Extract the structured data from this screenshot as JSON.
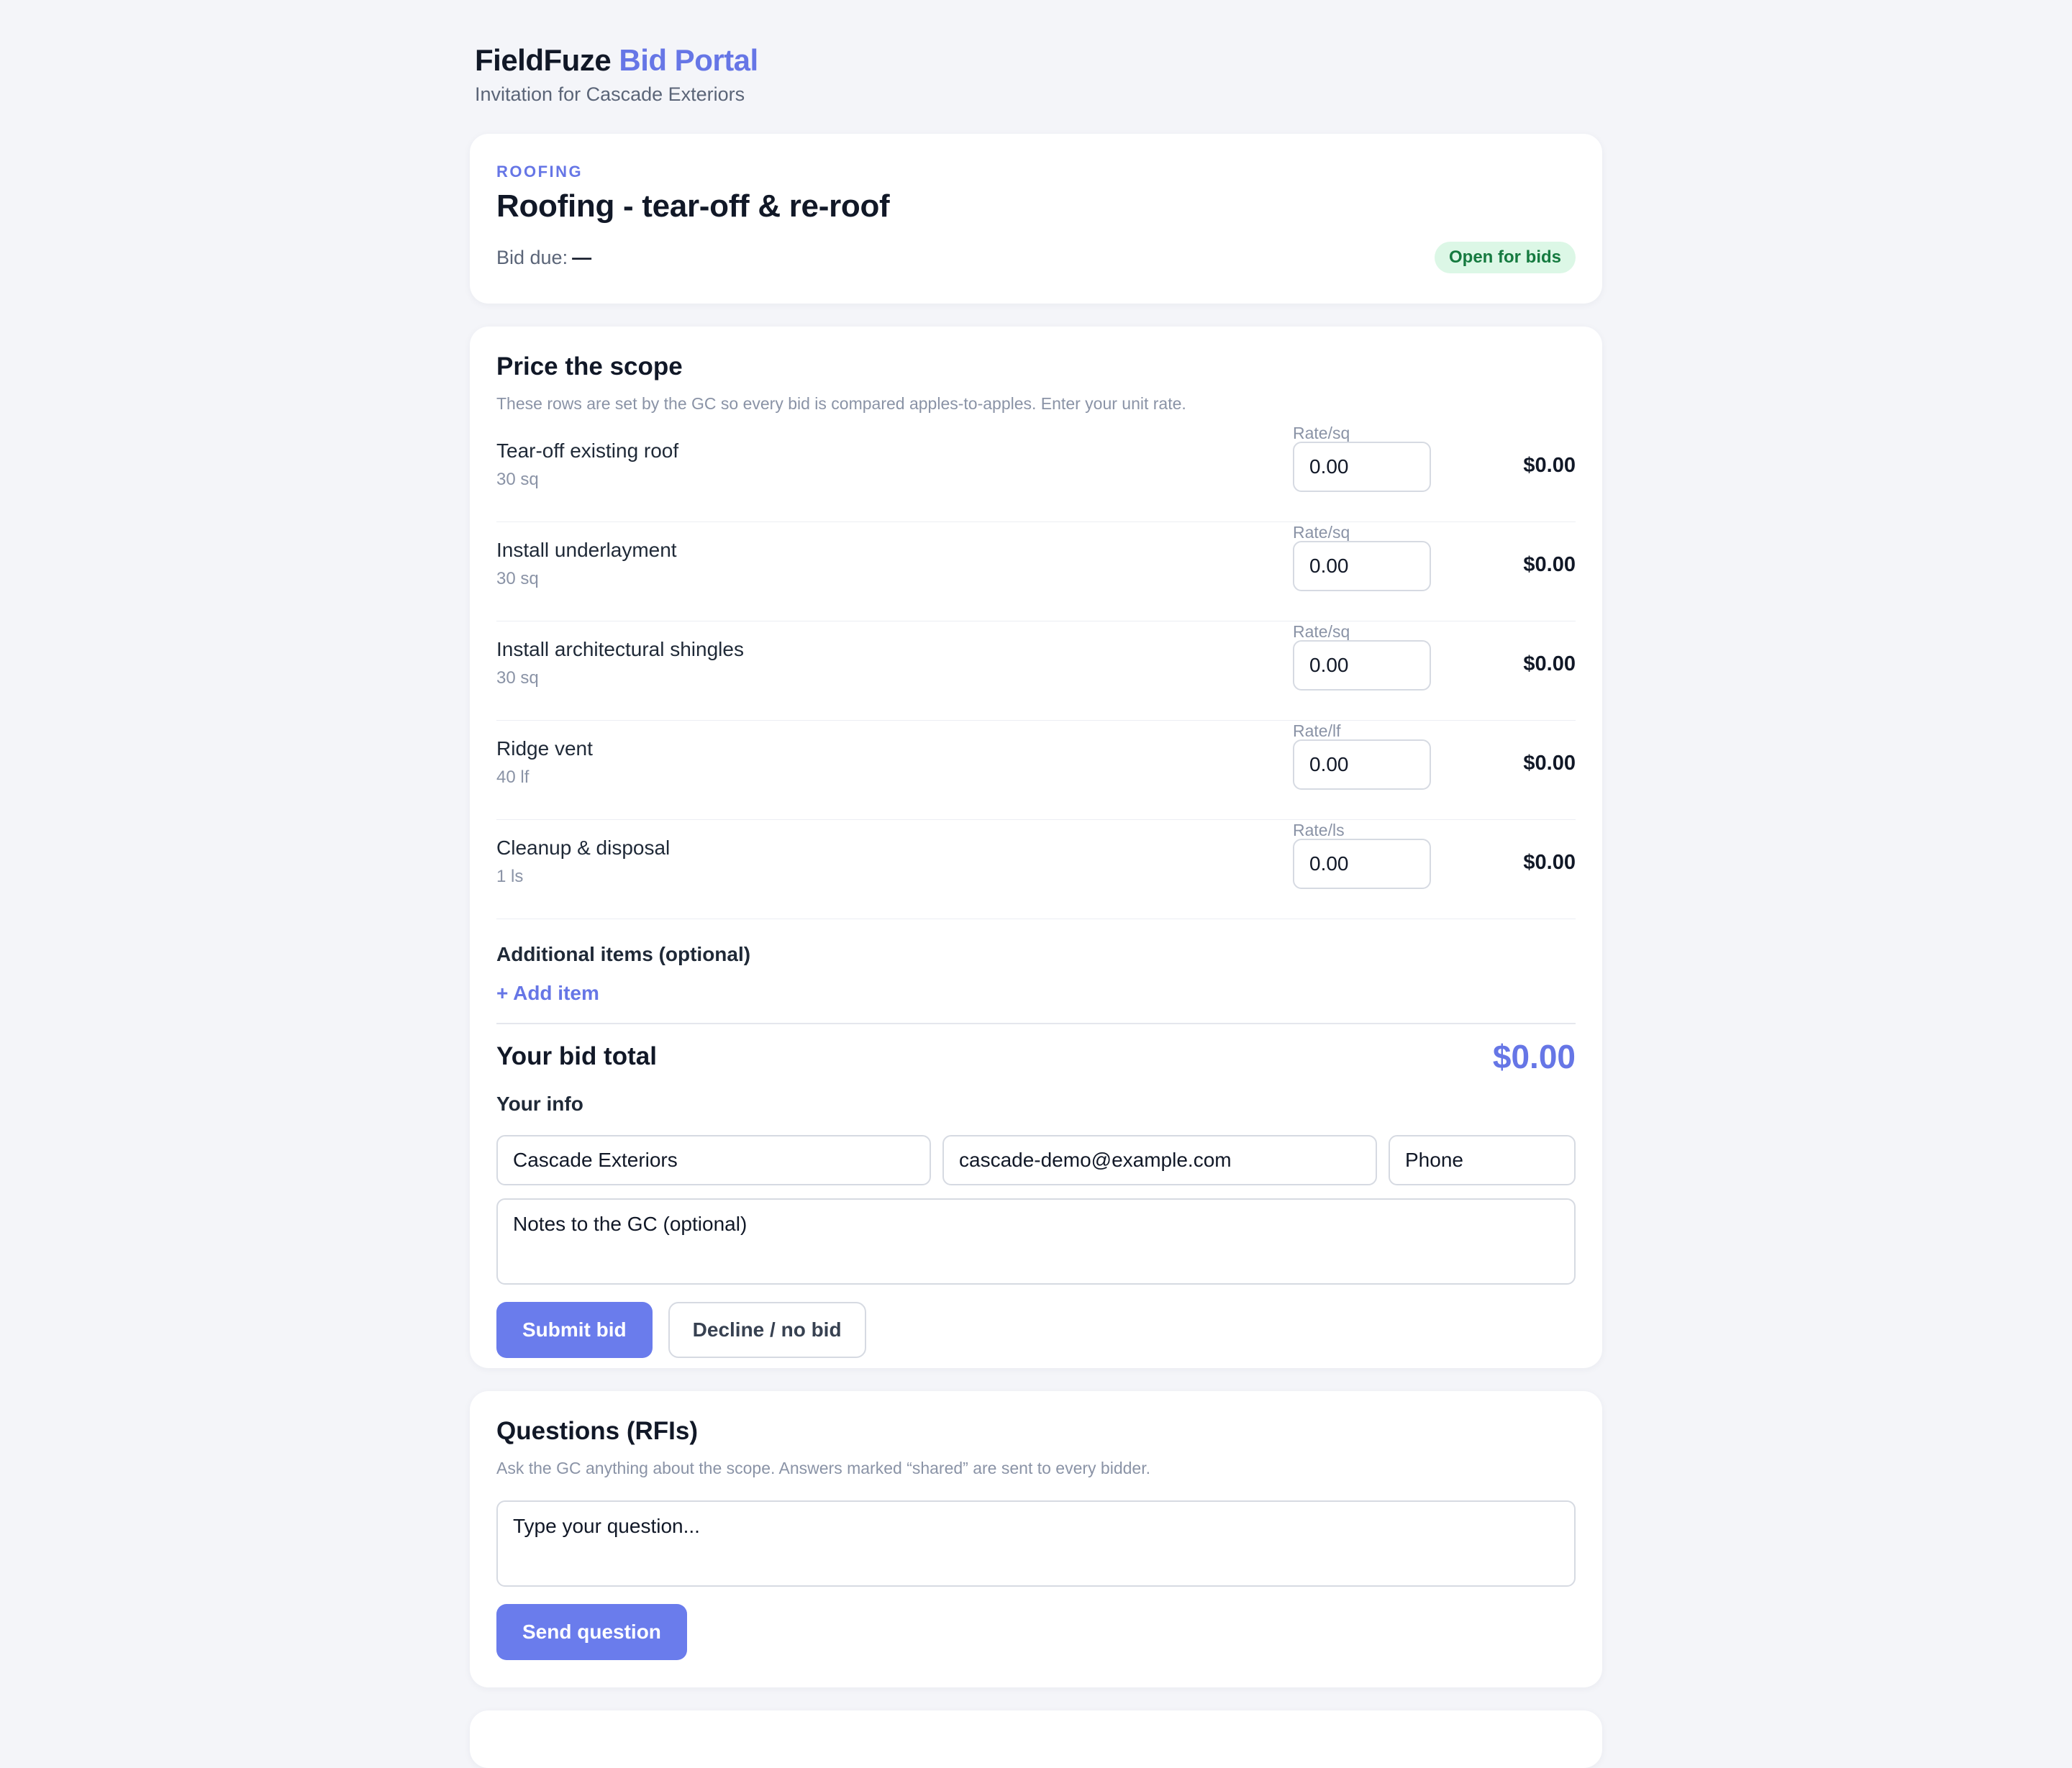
{
  "header": {
    "brand_main": "FieldFuze",
    "brand_accent": "Bid Portal",
    "subtitle": "Invitation for Cascade Exteriors"
  },
  "job": {
    "trade": "ROOFING",
    "title": "Roofing - tear-off & re-roof",
    "due_label": "Bid due:",
    "due_value": "—",
    "status": "Open for bids"
  },
  "scope": {
    "title": "Price the scope",
    "description": "These rows are set by the GC so every bid is compared apples-to-apples. Enter your unit rate.",
    "items": [
      {
        "name": "Tear-off existing roof",
        "qty": "30 sq",
        "rate_label": "Rate/sq",
        "rate": "0.00",
        "total": "$0.00"
      },
      {
        "name": "Install underlayment",
        "qty": "30 sq",
        "rate_label": "Rate/sq",
        "rate": "0.00",
        "total": "$0.00"
      },
      {
        "name": "Install architectural shingles",
        "qty": "30 sq",
        "rate_label": "Rate/sq",
        "rate": "0.00",
        "total": "$0.00"
      },
      {
        "name": "Ridge vent",
        "qty": "40 lf",
        "rate_label": "Rate/lf",
        "rate": "0.00",
        "total": "$0.00"
      },
      {
        "name": "Cleanup & disposal",
        "qty": "1 ls",
        "rate_label": "Rate/ls",
        "rate": "0.00",
        "total": "$0.00"
      }
    ],
    "additional_title": "Additional items (optional)",
    "add_item_label": "+ Add item",
    "total_label": "Your bid total",
    "total_value": "$0.00"
  },
  "info": {
    "title": "Your info",
    "company": "Cascade Exteriors",
    "email": "cascade-demo@example.com",
    "phone_placeholder": "Phone",
    "notes_placeholder": "Notes to the GC (optional)",
    "submit_label": "Submit bid",
    "decline_label": "Decline / no bid"
  },
  "rfi": {
    "title": "Questions (RFIs)",
    "description": "Ask the GC anything about the scope. Answers marked “shared” are sent to every bidder.",
    "placeholder": "Type your question...",
    "send_label": "Send question"
  },
  "colors": {
    "accent": "#6676e6",
    "background": "#f4f5f9",
    "badge_bg": "#dcf7e6",
    "badge_text": "#157a3f"
  }
}
